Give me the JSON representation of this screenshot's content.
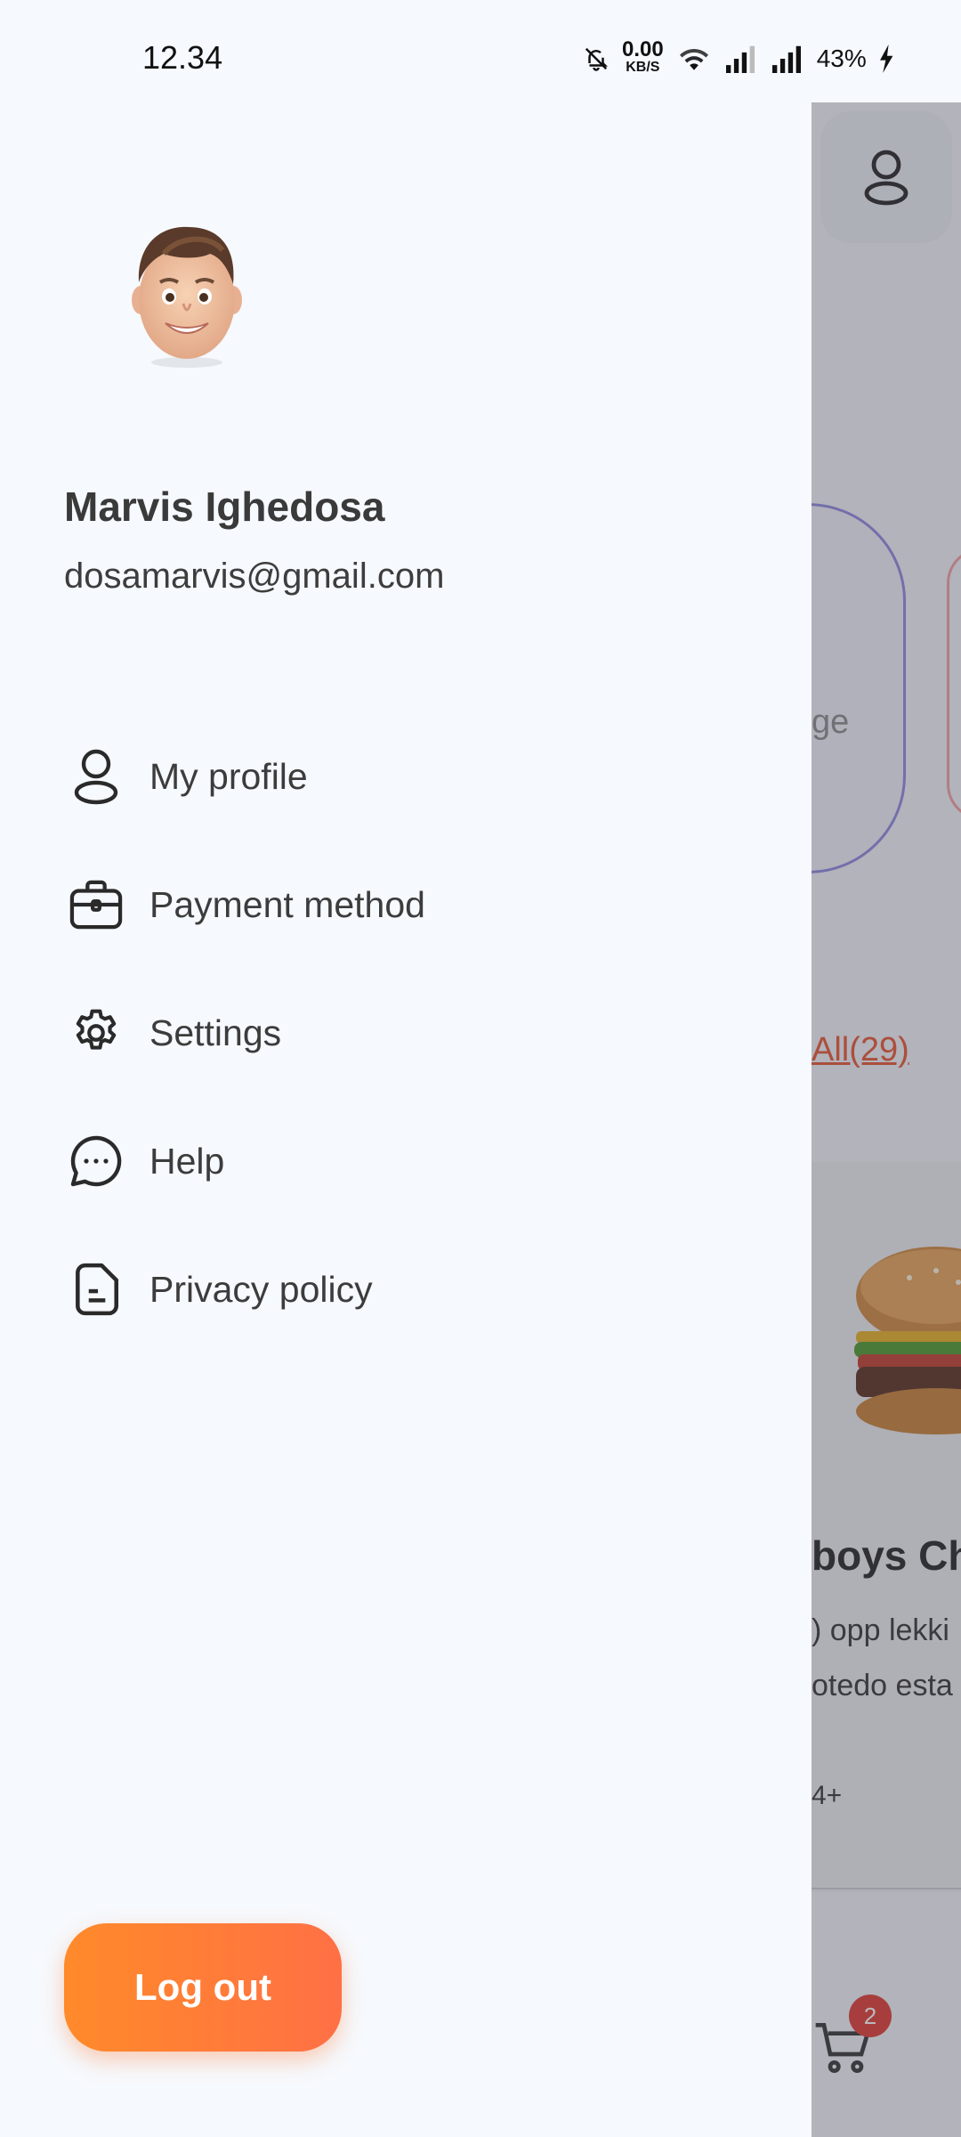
{
  "status_bar": {
    "time": "12.34",
    "net_speed": "0.00",
    "net_unit": "KB/S",
    "battery": "43%"
  },
  "drawer": {
    "user": {
      "name": "Marvis Ighedosa",
      "email": "dosamarvis@gmail.com"
    },
    "menu": [
      {
        "label": "My profile",
        "icon": "user-icon"
      },
      {
        "label": "Payment method",
        "icon": "briefcase-icon"
      },
      {
        "label": "Settings",
        "icon": "gear-icon"
      },
      {
        "label": "Help",
        "icon": "chat-bubble-icon"
      },
      {
        "label": "Privacy policy",
        "icon": "document-icon"
      }
    ],
    "logout_label": "Log out"
  },
  "background": {
    "card_text": "ge",
    "see_all": "All(29)",
    "food_title": "boys Ch",
    "food_desc_line1": ") opp lekki",
    "food_desc_line2": "otedo esta",
    "food_count": "4+",
    "cart_badge": "2"
  }
}
